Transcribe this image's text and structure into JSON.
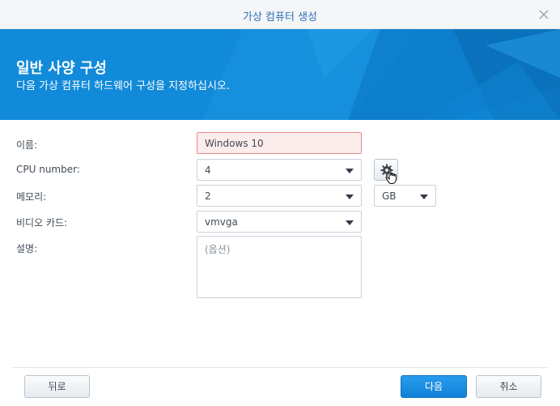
{
  "window": {
    "title": "가상 컴퓨터 생성",
    "close_icon": "close-icon"
  },
  "banner": {
    "heading": "일반 사양 구성",
    "subheading": "다음 가상 컴퓨터 하드웨어 구성을 지정하십시오.",
    "color": "#118ad9"
  },
  "form": {
    "name": {
      "label": "이름:",
      "value": "Windows 10"
    },
    "cpu": {
      "label": "CPU number:",
      "value": "4"
    },
    "memory": {
      "label": "메모리:",
      "value": "2",
      "unit": "GB"
    },
    "video": {
      "label": "비디오 카드:",
      "value": "vmvga"
    },
    "description": {
      "label": "설명:",
      "placeholder": "(옵션)"
    }
  },
  "footer": {
    "back_label": "뒤로",
    "next_label": "다음",
    "cancel_label": "취소"
  }
}
